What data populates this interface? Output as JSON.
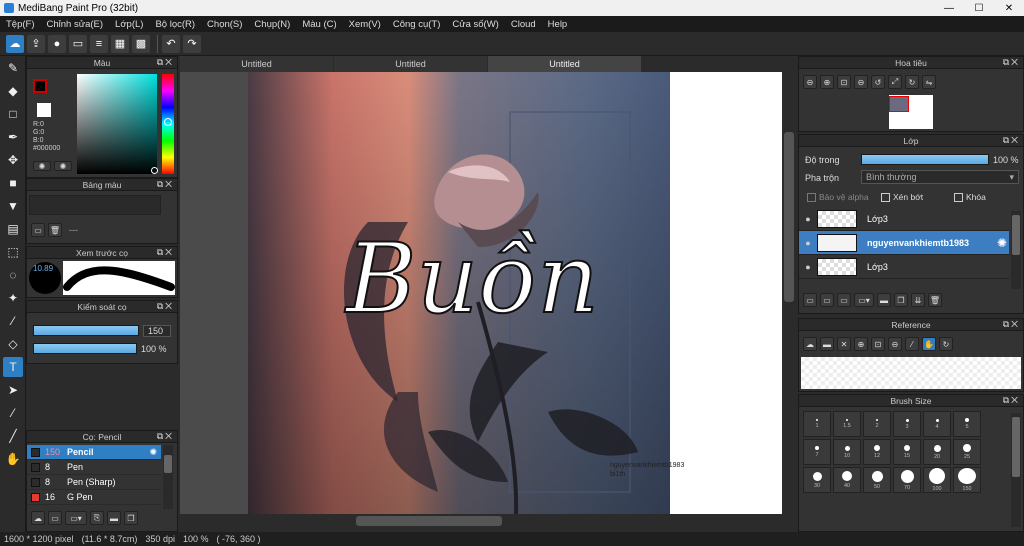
{
  "window": {
    "title": "MediBang Paint Pro (32bit)",
    "controls": [
      "—",
      "☐",
      "✕"
    ]
  },
  "menu": [
    "Tệp(F)",
    "Chỉnh sửa(E)",
    "Lớp(L)",
    "Bộ lọc(R)",
    "Chọn(S)",
    "Chụp(N)",
    "Màu (C)",
    "Xem(V)",
    "Công cụ(T)",
    "Cửa số(W)",
    "Cloud",
    "Help"
  ],
  "toolbar": {
    "icons": [
      "cloud-icon",
      "upload-icon",
      "comment-icon",
      "page-icon",
      "page-list-icon",
      "grid-icon",
      "grid2-icon",
      "undo-icon",
      "redo-icon"
    ]
  },
  "tools": [
    "brush-icon",
    "eraser-icon",
    "rectangle-icon",
    "pen-icon",
    "move-icon",
    "fill-rect-icon",
    "bucket-icon",
    "gradient-icon",
    "select-rect-icon",
    "lasso-icon",
    "magic-wand-icon",
    "select-pen-icon",
    "select-eraser-icon",
    "text-icon",
    "operation-icon",
    "eyedropper-icon",
    "dropper2-icon",
    "hand-icon"
  ],
  "color_panel": {
    "title": "Màu",
    "r": "R:0",
    "g": "G:0",
    "b": "B:0",
    "hex": "#000000",
    "fg": "#000000",
    "bg": "#ffffff"
  },
  "palette_panel": {
    "title": "Bảng màu",
    "placeholder": "---"
  },
  "preview_panel": {
    "title": "Xem trước cọ",
    "size": "10.89"
  },
  "control_panel": {
    "title": "Kiểm soát cọ",
    "size_value": "150",
    "opacity_value": "100 %"
  },
  "brush_panel": {
    "title": "Cọ: Pencil",
    "items": [
      {
        "size": "150",
        "name": "Pencil",
        "color": "#2b2b2b",
        "active": true
      },
      {
        "size": "8",
        "name": "Pen",
        "color": "#2b2b2b",
        "active": false
      },
      {
        "size": "8",
        "name": "Pen (Sharp)",
        "color": "#2b2b2b",
        "active": false
      },
      {
        "size": "16",
        "name": "G Pen",
        "color": "#e53935",
        "active": false
      }
    ]
  },
  "tabs": [
    {
      "label": "Untitled",
      "active": false
    },
    {
      "label": "Untitled",
      "active": false
    },
    {
      "label": "Untitled",
      "active": true
    }
  ],
  "canvas": {
    "lettering": "Buồn",
    "watermark_1": "nguyenvankhiemtb1983",
    "watermark_2": "bi1th"
  },
  "status": {
    "size": "1600 * 1200 pixel",
    "cm": "(11.6 * 8.7cm)",
    "dpi": "350 dpi",
    "zoom": "100 %",
    "coords": "( -76, 360 )"
  },
  "navigator": {
    "title": "Hoa tiêu"
  },
  "layer_panel": {
    "title": "Lớp",
    "opacity_label": "Độ trong",
    "opacity_value": "100 %",
    "opacity": 100,
    "blend_label": "Pha trộn",
    "blend_value": "Bình thường",
    "protect_alpha": "Bảo vệ alpha",
    "clipping": "Xén bớt",
    "lock": "Khóa",
    "layers": [
      {
        "name": "Lớp3",
        "active": false
      },
      {
        "name": "nguyenvankhiemtb1983",
        "active": true
      },
      {
        "name": "Lớp3",
        "active": false
      }
    ]
  },
  "reference_panel": {
    "title": "Reference"
  },
  "brush_size_panel": {
    "title": "Brush Size",
    "sizes": [
      "1",
      "1.5",
      "2",
      "3",
      "4",
      "5",
      "7",
      "10",
      "12",
      "15",
      "20",
      "25",
      "30",
      "40",
      "50",
      "70",
      "100",
      "150"
    ]
  },
  "colors": {
    "accent": "#2f7fc5",
    "panel": "#333333",
    "bg": "#2b2b2b"
  }
}
